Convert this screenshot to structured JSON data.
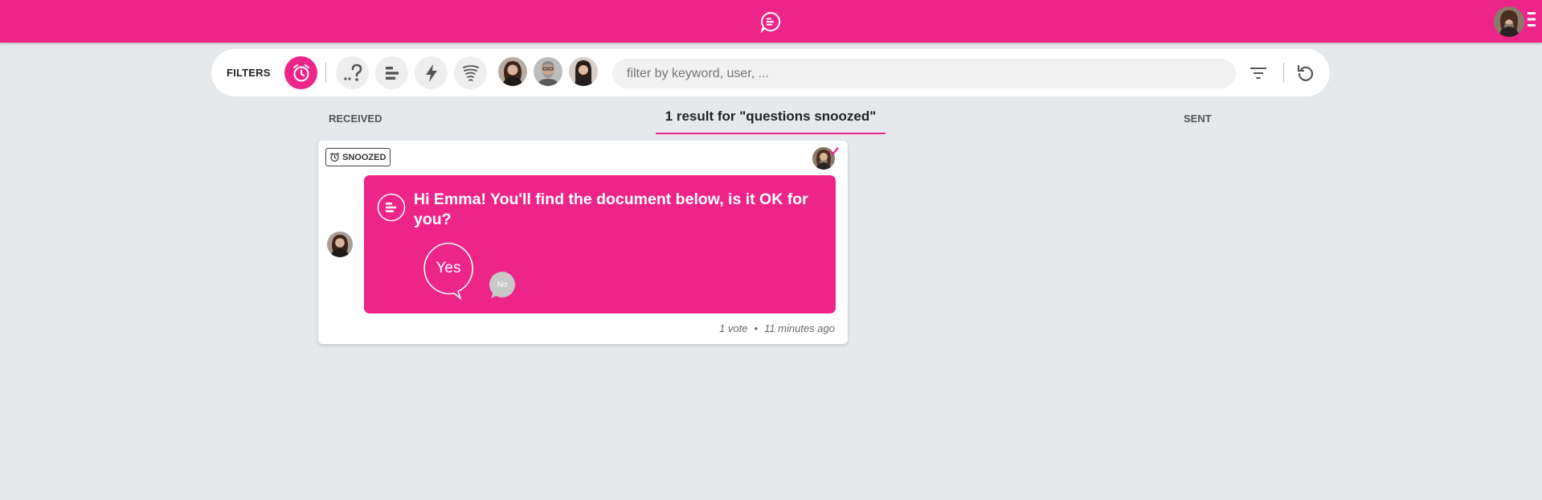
{
  "header": {
    "logo_icon": "chat-bubble-lines-icon",
    "menu_icon": "vertical-menu-icon",
    "colors": {
      "brand": "#ee2589",
      "background": "#e6e9ec"
    }
  },
  "filters": {
    "label": "FILTERS",
    "buttons": [
      {
        "icon": "alarm-clock-icon",
        "active": true
      },
      {
        "icon": "question-dots-icon",
        "active": false
      },
      {
        "icon": "poll-bars-icon",
        "active": false
      },
      {
        "icon": "lightning-icon",
        "active": false
      },
      {
        "icon": "tornado-icon",
        "active": false
      }
    ],
    "users": [
      "user-avatar-1",
      "user-avatar-2",
      "user-avatar-3"
    ],
    "search_placeholder": "filter by keyword, user, ...",
    "sort_icon": "filter-lines-icon",
    "refresh_icon": "refresh-icon"
  },
  "tabs": {
    "received": "RECEIVED",
    "results": "1 result for \"questions snoozed\"",
    "sent": "SENT"
  },
  "card": {
    "badge": "SNOOZED",
    "question": "Hi Emma! You'll find the document below, is it OK for you?",
    "options": {
      "yes": "Yes",
      "no": "No"
    },
    "votes": "1 vote",
    "time": "11 minutes ago"
  }
}
